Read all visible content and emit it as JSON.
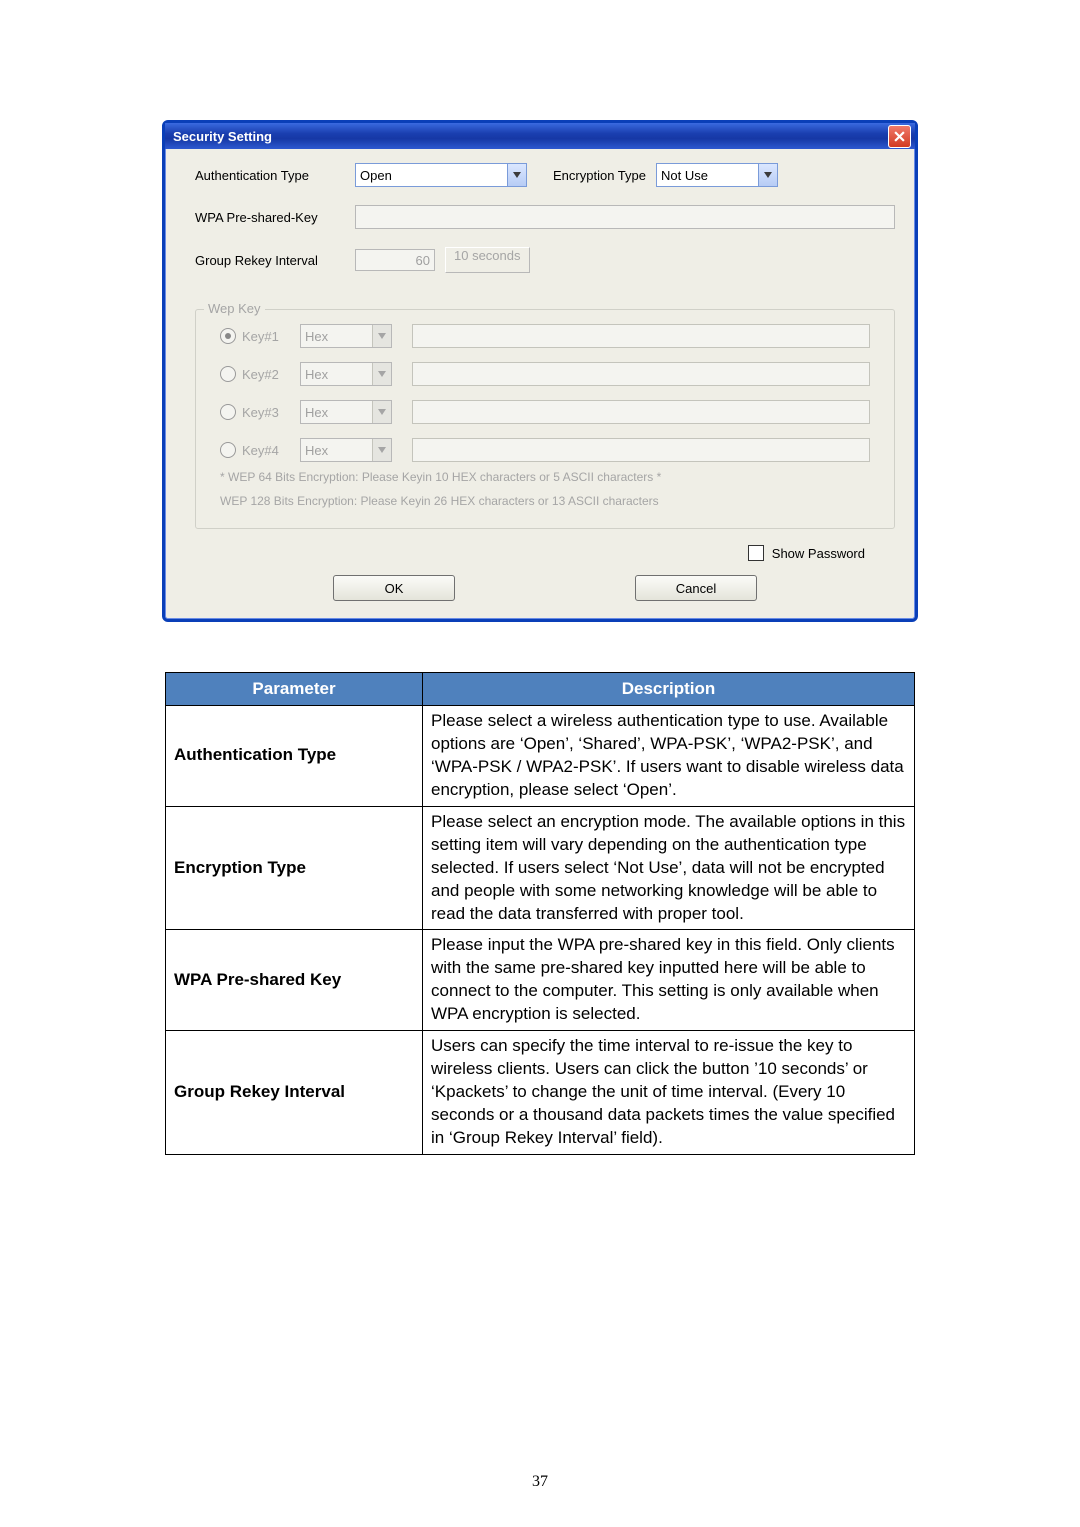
{
  "dialog": {
    "title": "Security Setting",
    "auth_label": "Authentication Type",
    "auth_value": "Open",
    "enc_label": "Encryption Type",
    "enc_value": "Not Use",
    "psk_label": "WPA Pre-shared-Key",
    "rekey_label": "Group Rekey Interval",
    "rekey_value": "60",
    "rekey_unit": "10 seconds",
    "wep": {
      "legend": "Wep Key",
      "rows": [
        {
          "radio_selected": true,
          "label": "Key#1",
          "mode": "Hex"
        },
        {
          "radio_selected": false,
          "label": "Key#2",
          "mode": "Hex"
        },
        {
          "radio_selected": false,
          "label": "Key#3",
          "mode": "Hex"
        },
        {
          "radio_selected": false,
          "label": "Key#4",
          "mode": "Hex"
        }
      ],
      "note1": "* WEP 64 Bits Encryption:  Please Keyin 10 HEX characters or 5 ASCII characters *",
      "note2": "WEP 128 Bits Encryption:  Please Keyin 26 HEX characters or 13 ASCII characters"
    },
    "show_password": "Show Password",
    "ok": "OK",
    "cancel": "Cancel"
  },
  "table": {
    "head_param": "Parameter",
    "head_desc": "Description",
    "rows": [
      {
        "param": "Authentication Type",
        "desc": "Please select a wireless authentication type to use. Available options are ‘Open’, ‘Shared’, WPA-PSK’, ‘WPA2-PSK’, and ‘WPA-PSK / WPA2-PSK’. If users want to disable wireless data encryption, please select ‘Open’."
      },
      {
        "param": "Encryption Type",
        "desc": "Please select an encryption mode. The available options in this setting item will vary depending on the authentication type selected. If users select ‘Not Use’, data will not be encrypted and people with some networking knowledge will be able to read the data transferred with proper tool."
      },
      {
        "param": "WPA Pre-shared Key",
        "desc": "Please input the WPA pre-shared key in this field. Only clients with the same pre-shared key inputted here will be able to connect to the computer. This setting is only available when WPA encryption is selected."
      },
      {
        "param": "Group Rekey Interval",
        "desc": "Users can specify the time interval to re-issue the key to wireless clients. Users can click the button ’10 seconds’ or ‘Kpackets’ to change the unit of time interval. (Every 10 seconds or a thousand data packets times the value specified in ‘Group Rekey Interval’ field)."
      }
    ]
  },
  "page_number": "37"
}
